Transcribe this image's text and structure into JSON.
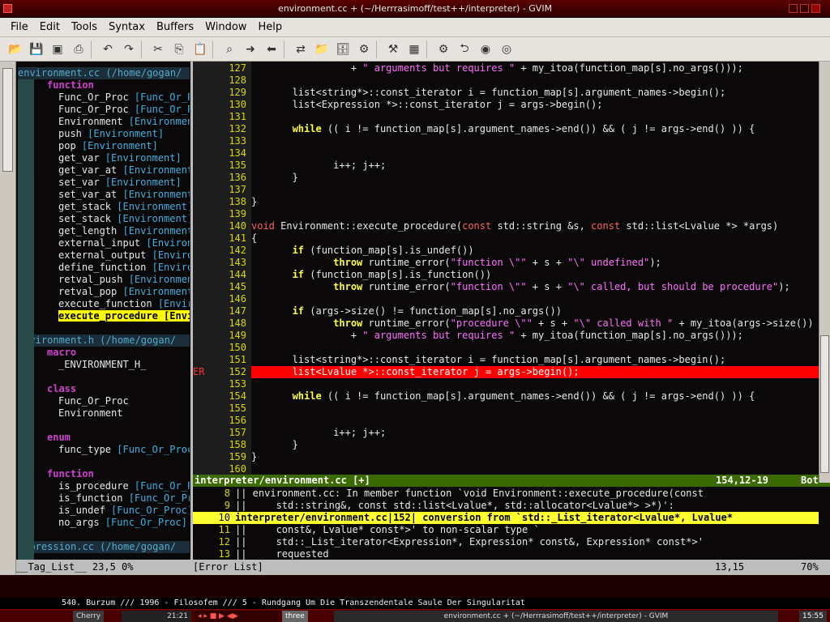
{
  "window": {
    "title": "environment.cc + (~/Herrrasimoff/test++/interpreter) - GVIM"
  },
  "menu": [
    "File",
    "Edit",
    "Tools",
    "Syntax",
    "Buffers",
    "Window",
    "Help"
  ],
  "toolbar_icons": [
    "open-icon",
    "save-icon",
    "save-all-icon",
    "print-icon",
    "undo-icon",
    "redo-icon",
    "cut-icon",
    "copy-icon",
    "paste-icon",
    "find-icon",
    "find-next-icon",
    "find-prev-icon",
    "replace-icon",
    "load-session-icon",
    "save-session-icon",
    "run-script-icon",
    "make-icon",
    "table-icon",
    "build-tags-icon",
    "jump-tag-icon",
    "help-icon",
    "find-help-icon"
  ],
  "taglist": [
    {
      "kind": "hdr",
      "text": "environment.cc (/home/gogan/"
    },
    {
      "kind": "kw",
      "text": "function"
    },
    {
      "kind": "item",
      "name": "Func_Or_Proc ",
      "scope": "[Func_Or_P"
    },
    {
      "kind": "item",
      "name": "Func_Or_Proc ",
      "scope": "[Func_Or_P"
    },
    {
      "kind": "item",
      "name": "Environment ",
      "scope": "[Environmen"
    },
    {
      "kind": "item",
      "name": "push ",
      "scope": "[Environment]"
    },
    {
      "kind": "item",
      "name": "pop ",
      "scope": "[Environment]"
    },
    {
      "kind": "item",
      "name": "get_var ",
      "scope": "[Environment]"
    },
    {
      "kind": "item",
      "name": "get_var_at ",
      "scope": "[Environment]"
    },
    {
      "kind": "item",
      "name": "set_var ",
      "scope": "[Environment]"
    },
    {
      "kind": "item",
      "name": "set_var_at ",
      "scope": "[Environment]"
    },
    {
      "kind": "item",
      "name": "get_stack ",
      "scope": "[Environment]"
    },
    {
      "kind": "item",
      "name": "set_stack ",
      "scope": "[Environment]"
    },
    {
      "kind": "item",
      "name": "get_length ",
      "scope": "[Environment]"
    },
    {
      "kind": "item",
      "name": "external_input ",
      "scope": "[Environ"
    },
    {
      "kind": "item",
      "name": "external_output ",
      "scope": "[Enviro"
    },
    {
      "kind": "item",
      "name": "define_function ",
      "scope": "[Enviro"
    },
    {
      "kind": "item",
      "name": "retval_push ",
      "scope": "[Environmen"
    },
    {
      "kind": "item",
      "name": "retval_pop ",
      "scope": "[Environment"
    },
    {
      "kind": "item",
      "name": "execute_function ",
      "scope": "[Envir"
    },
    {
      "kind": "sel",
      "text": "execute_procedure [Envi"
    },
    {
      "kind": "blank",
      "text": ""
    },
    {
      "kind": "hdr",
      "text": "environment.h (/home/gogan/"
    },
    {
      "kind": "kw",
      "text": "macro"
    },
    {
      "kind": "item",
      "name": "_ENVIRONMENT_H_",
      "scope": ""
    },
    {
      "kind": "blank",
      "text": ""
    },
    {
      "kind": "kw",
      "text": "class"
    },
    {
      "kind": "item",
      "name": "Func_Or_Proc",
      "scope": ""
    },
    {
      "kind": "item",
      "name": "Environment",
      "scope": ""
    },
    {
      "kind": "blank",
      "text": ""
    },
    {
      "kind": "kw",
      "text": "enum"
    },
    {
      "kind": "item",
      "name": "func_type ",
      "scope": "[Func_Or_Proc"
    },
    {
      "kind": "blank",
      "text": ""
    },
    {
      "kind": "kw",
      "text": "function"
    },
    {
      "kind": "item",
      "name": "is_procedure ",
      "scope": "[Func_Or_P"
    },
    {
      "kind": "item",
      "name": "is_function ",
      "scope": "[Func_Or_Pr"
    },
    {
      "kind": "item",
      "name": "is_undef ",
      "scope": "[Func_Or_Proc]"
    },
    {
      "kind": "item",
      "name": "no_args ",
      "scope": "[Func_Or_Proc]"
    },
    {
      "kind": "blank",
      "text": ""
    },
    {
      "kind": "hdr",
      "text": "expression.cc (/home/gogan/"
    }
  ],
  "code": [
    {
      "n": "127",
      "sign": "",
      "segs": [
        [
          "c",
          "                 + "
        ],
        [
          "s",
          "\" arguments but requires \""
        ],
        [
          "c",
          " + my_itoa(function_map[s].no_args()));"
        ]
      ]
    },
    {
      "n": "128",
      "sign": "",
      "segs": []
    },
    {
      "n": "129",
      "sign": "",
      "segs": [
        [
          "c",
          "       list<string*>::const_iterator i = function_map[s].argument_names->begin();"
        ]
      ]
    },
    {
      "n": "130",
      "sign": "",
      "segs": [
        [
          "c",
          "       list<Expression *>::const_iterator j = args->begin();"
        ]
      ]
    },
    {
      "n": "131",
      "sign": "",
      "segs": []
    },
    {
      "n": "132",
      "sign": "",
      "segs": [
        [
          "c",
          "       "
        ],
        [
          "k",
          "while"
        ],
        [
          "c",
          " (( i != function_map[s].argument_names->end()) && ( j != args->end() )) {"
        ]
      ]
    },
    {
      "n": "133",
      "sign": "",
      "segs": []
    },
    {
      "n": "134",
      "sign": "",
      "segs": []
    },
    {
      "n": "135",
      "sign": "",
      "segs": [
        [
          "c",
          "              i++; j++;"
        ]
      ]
    },
    {
      "n": "136",
      "sign": "",
      "segs": [
        [
          "c",
          "       }"
        ]
      ]
    },
    {
      "n": "137",
      "sign": "",
      "segs": []
    },
    {
      "n": "138",
      "sign": "",
      "segs": [
        [
          "c",
          "}"
        ]
      ]
    },
    {
      "n": "139",
      "sign": "",
      "segs": []
    },
    {
      "n": "140",
      "sign": "",
      "segs": [
        [
          "t",
          "void"
        ],
        [
          "c",
          " Environment::execute_procedure("
        ],
        [
          "t",
          "const"
        ],
        [
          "c",
          " std::string &s, "
        ],
        [
          "t",
          "const"
        ],
        [
          "c",
          " std::list<Lvalue *> *args)"
        ]
      ]
    },
    {
      "n": "141",
      "sign": "",
      "segs": [
        [
          "c",
          "{"
        ]
      ]
    },
    {
      "n": "142",
      "sign": "",
      "segs": [
        [
          "c",
          "       "
        ],
        [
          "k",
          "if"
        ],
        [
          "c",
          " (function_map[s].is_undef())"
        ]
      ]
    },
    {
      "n": "143",
      "sign": "",
      "segs": [
        [
          "c",
          "              "
        ],
        [
          "k",
          "throw"
        ],
        [
          "c",
          " runtime_error("
        ],
        [
          "s",
          "\"function \\\"\""
        ],
        [
          "c",
          " + s + "
        ],
        [
          "s",
          "\"\\\" undefined\""
        ],
        [
          "c",
          ");"
        ]
      ]
    },
    {
      "n": "144",
      "sign": "",
      "segs": [
        [
          "c",
          "       "
        ],
        [
          "k",
          "if"
        ],
        [
          "c",
          " (function_map[s].is_function())"
        ]
      ]
    },
    {
      "n": "145",
      "sign": "",
      "segs": [
        [
          "c",
          "              "
        ],
        [
          "k",
          "throw"
        ],
        [
          "c",
          " runtime_error("
        ],
        [
          "s",
          "\"function \\\"\""
        ],
        [
          "c",
          " + s + "
        ],
        [
          "s",
          "\"\\\" called, but should be procedure\""
        ],
        [
          "c",
          ");"
        ]
      ]
    },
    {
      "n": "146",
      "sign": "",
      "segs": []
    },
    {
      "n": "147",
      "sign": "",
      "segs": [
        [
          "c",
          "       "
        ],
        [
          "k",
          "if"
        ],
        [
          "c",
          " (args->size() != function_map[s].no_args())"
        ]
      ]
    },
    {
      "n": "148",
      "sign": "",
      "segs": [
        [
          "c",
          "              "
        ],
        [
          "k",
          "throw"
        ],
        [
          "c",
          " runtime_error("
        ],
        [
          "s",
          "\"procedure \\\"\""
        ],
        [
          "c",
          " + s + "
        ],
        [
          "s",
          "\"\\\" called with \""
        ],
        [
          "c",
          " + my_itoa(args->size())"
        ]
      ]
    },
    {
      "n": "149",
      "sign": "",
      "segs": [
        [
          "c",
          "                 + "
        ],
        [
          "s",
          "\" arguments but requires \""
        ],
        [
          "c",
          " + my_itoa(function_map[s].no_args()));"
        ]
      ]
    },
    {
      "n": "150",
      "sign": "",
      "segs": []
    },
    {
      "n": "151",
      "sign": "",
      "segs": [
        [
          "c",
          "       list<string*>::const_iterator i = function_map[s].argument_names->begin();"
        ]
      ]
    },
    {
      "n": "152",
      "sign": "ER",
      "segs": [
        [
          "c",
          "       list<Lvalue *>::const_iterator j = args->begin();"
        ]
      ]
    },
    {
      "n": "153",
      "sign": "",
      "segs": []
    },
    {
      "n": "154",
      "sign": "",
      "segs": [
        [
          "c",
          "       "
        ],
        [
          "k",
          "while"
        ],
        [
          "c",
          " (( i != function_map[s].argument_names->end()) && ( j != args->end() )) {"
        ]
      ]
    },
    {
      "n": "155",
      "sign": "",
      "segs": []
    },
    {
      "n": "156",
      "sign": "",
      "segs": []
    },
    {
      "n": "157",
      "sign": "",
      "segs": [
        [
          "c",
          "              i++; j++;"
        ]
      ]
    },
    {
      "n": "158",
      "sign": "",
      "segs": [
        [
          "c",
          "       }"
        ]
      ]
    },
    {
      "n": "159",
      "sign": "",
      "segs": [
        [
          "c",
          "}"
        ]
      ]
    },
    {
      "n": "160",
      "sign": "",
      "segs": []
    }
  ],
  "status": {
    "file": "interpreter/environment.cc [+]",
    "pos": "154,12-19",
    "pct": "Bot"
  },
  "quickfix": [
    {
      "n": "8",
      "text": "|| environment.cc: In member function `void Environment::execute_procedure(const"
    },
    {
      "n": "9",
      "text": "||     std::string&, const std::list<Lvalue*, std::allocator<Lvalue*> >*)':"
    },
    {
      "n": "10",
      "text": "interpreter/environment.cc|152| conversion from `std::_List_iterator<Lvalue*, Lvalue*",
      "hl": true
    },
    {
      "n": "11",
      "text": "||     const&, Lvalue* const*>' to non-scalar type `"
    },
    {
      "n": "12",
      "text": "||     std::_List_iterator<Expression*, Expression* const&, Expression* const*>'"
    },
    {
      "n": "13",
      "text": "||     requested"
    }
  ],
  "bottom_status": {
    "left": "__Tag_List__   23,5           0%",
    "mid": " [Error List]",
    "right_pos": "13,15",
    "right_pct": "70%"
  },
  "music": "540. Burzum /// 1996 - Filosofem /// 5 - Rundgang Um Die Transzendentale Saule Der Singularitat",
  "taskbar": {
    "app": "Cherry",
    "time1": "21:21",
    "desk": "three",
    "window": "environment.cc + (~/Herrrasimoff/test++/interpreter) - GVIM",
    "clock": "15:55"
  },
  "colors": {
    "titlebar": "#3a0000",
    "status": "#3a6a00",
    "error": "#ff0000",
    "linenr": "#d8d800",
    "keyword": "#ffff40",
    "type": "#ff6060",
    "string": "#ff70ff"
  }
}
